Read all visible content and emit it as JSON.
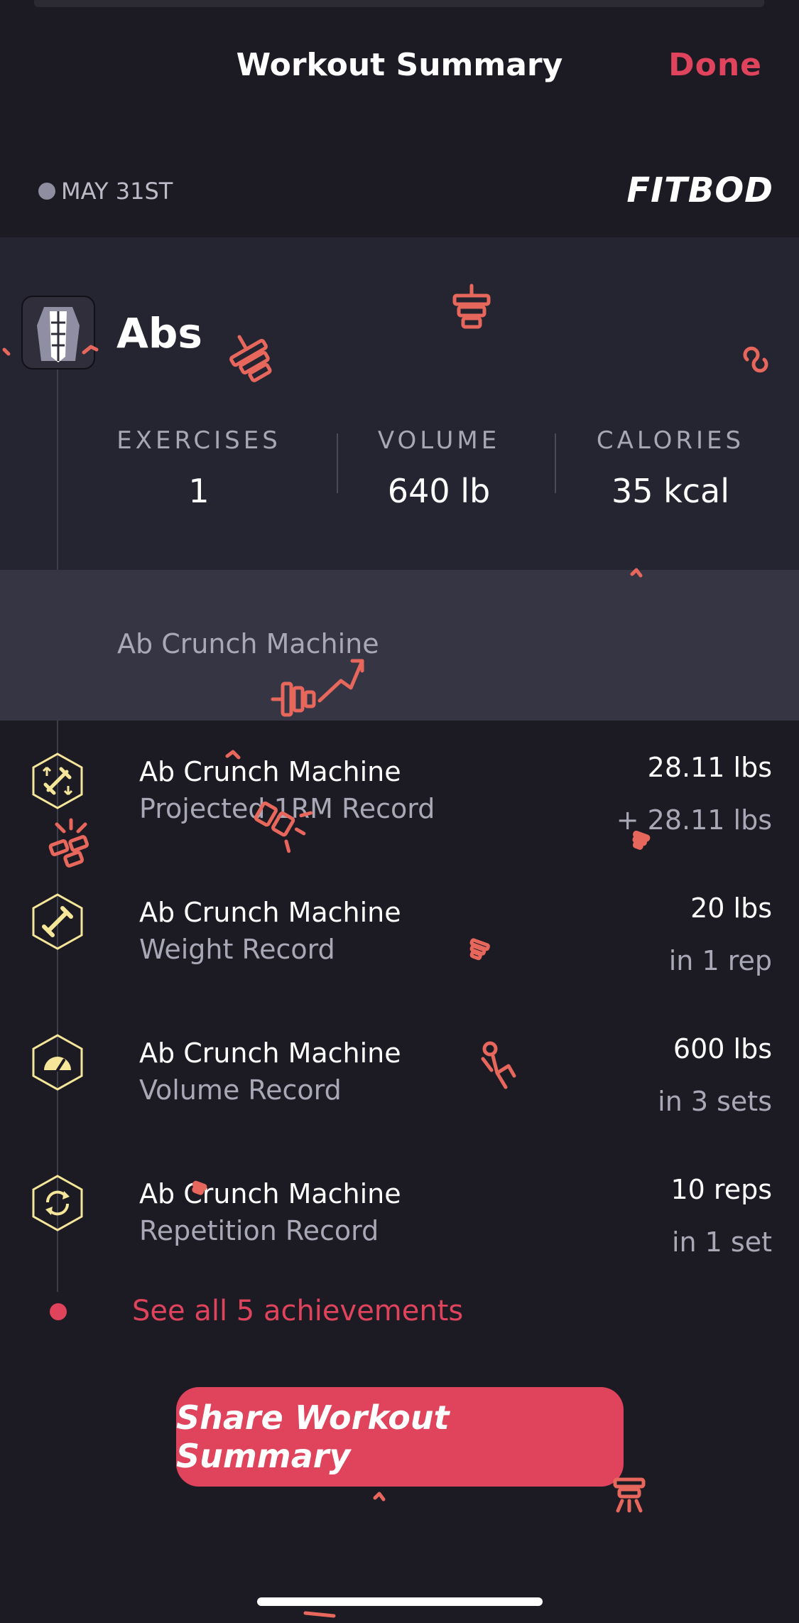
{
  "header": {
    "title": "Workout Summary",
    "done_label": "Done"
  },
  "meta": {
    "date": "MAY 31ST",
    "brand": "FITBOD"
  },
  "workout": {
    "muscle_group": "Abs",
    "stats": [
      {
        "label": "EXERCISES",
        "value": "1"
      },
      {
        "label": "VOLUME",
        "value": "640 lb"
      },
      {
        "label": "CALORIES",
        "value": "35 kcal"
      }
    ],
    "exercise": "Ab Crunch Machine"
  },
  "achievements": [
    {
      "name": "Ab Crunch Machine",
      "type": "Projected 1RM Record",
      "value": "28.11 lbs",
      "detail": "+ 28.11 lbs",
      "icon": "arrows-dumbbell-icon"
    },
    {
      "name": "Ab Crunch Machine",
      "type": "Weight Record",
      "value": "20 lbs",
      "detail": "in 1 rep",
      "icon": "dumbbell-icon"
    },
    {
      "name": "Ab Crunch Machine",
      "type": "Volume Record",
      "value": "600 lbs",
      "detail": "in 3 sets",
      "icon": "gauge-icon"
    },
    {
      "name": "Ab Crunch Machine",
      "type": "Repetition Record",
      "value": "10 reps",
      "detail": "in 1 set",
      "icon": "repeat-icon"
    }
  ],
  "see_all_label": "See all 5 achievements",
  "share_label": "Share Workout Summary",
  "colors": {
    "background": "#1c1b24",
    "accent": "#e0435c",
    "badge_outline": "#f5e69a",
    "confetti": "#e8675c"
  }
}
